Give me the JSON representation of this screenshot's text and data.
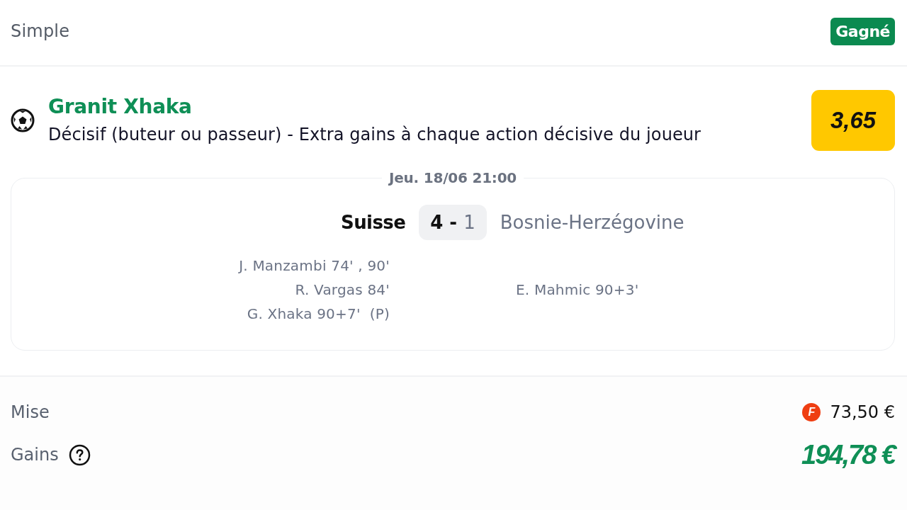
{
  "bet": {
    "type": "Simple",
    "status": {
      "label": "Gagné",
      "kind": "won"
    }
  },
  "selection": {
    "player": "Granit Xhaka",
    "market": "Décisif (buteur ou passeur) - Extra gains à chaque action décisive du joueur",
    "odds": "3,65"
  },
  "match": {
    "date": "Jeu. 18/06 21:00",
    "separator": "-",
    "home": {
      "team": "Suisse",
      "score": "4",
      "winner": true,
      "scorers": [
        "J. Manzambi 74' , 90'",
        "R. Vargas 84'",
        "G. Xhaka 90+7'  (P)"
      ]
    },
    "away": {
      "team": "Bosnie-Herzégovine",
      "score": "1",
      "winner": false,
      "scorers": [
        "E. Mahmic 90+3'"
      ]
    }
  },
  "summary": {
    "stake_label": "Mise",
    "stake_token": "F",
    "stake": "73,50 €",
    "winnings_label": "Gains",
    "winnings": "194,78 €"
  }
}
